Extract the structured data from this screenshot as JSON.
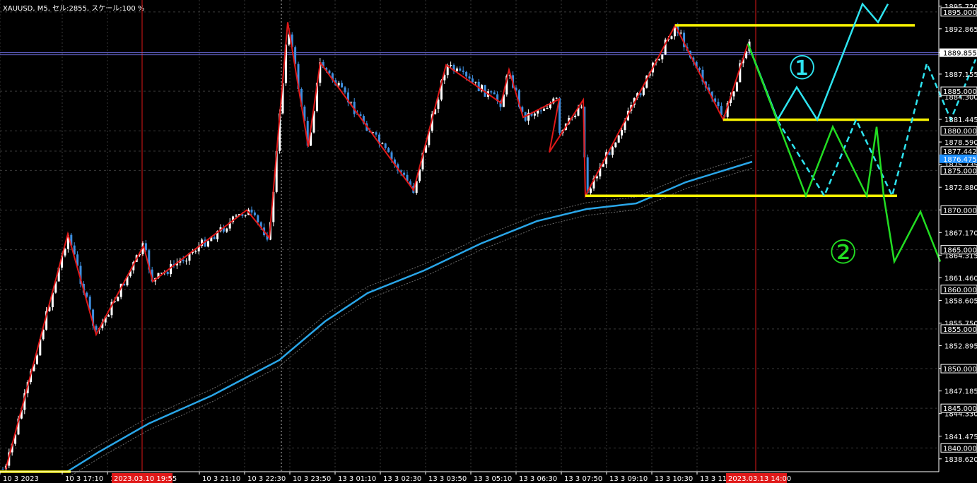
{
  "header": {
    "title": "XAUUSD, M5, セル:2855, スケール:100 %"
  },
  "colors": {
    "background": "#000000",
    "axis_text": "#ffffff",
    "grid": "#3a3a3a",
    "zigzag": "#e01818",
    "moving_average": "#2aa6e8",
    "envelope": "#6a6a6a",
    "support_resistance": "#f5f000",
    "scenario_1": "#2ee4f0",
    "scenario_2": "#22dd22",
    "current_price_tag": "#1e90ff",
    "date_tag": "#e01818",
    "bull_candle": "#ffffff",
    "bear_candle": "#3e8fe0"
  },
  "annotations": {
    "scenario_1_label": "①",
    "scenario_2_label": "②"
  },
  "chart_data": {
    "type": "candlestick",
    "symbol": "XAUUSD",
    "timeframe": "M5",
    "y_range": [
      1837.0,
      1896.5
    ],
    "price_labels": [
      "1895.720",
      "1892.865",
      "1889.855",
      "1887.155",
      "1884.300",
      "1881.445",
      "1878.590",
      "1875.735",
      "1872.880",
      "1870.025",
      "1867.170",
      "1864.315",
      "1861.460",
      "1858.605",
      "1855.750",
      "1852.895",
      "1850.040",
      "1847.185",
      "1844.330",
      "1841.475",
      "1838.620"
    ],
    "level_labels": [
      "1895.000",
      "1885.000",
      "1880.000",
      "1877.442",
      "1875.000",
      "1870.000",
      "1865.000",
      "1860.000",
      "1855.000",
      "1850.000",
      "1845.000",
      "1840.000"
    ],
    "current_price": "1876.475",
    "current_price_marker": "1889.855",
    "x_labels": [
      "10 3 2023",
      "10 3 17:10",
      "10 3 1",
      "10 3 21:10",
      "10 3 22:30",
      "10 3 23:50",
      "13 3 01:10",
      "13 3 02:30",
      "13 3 03:50",
      "13 3 05:10",
      "13 3 06:30",
      "13 3 07:50",
      "13 3 09:10",
      "13 3 10:30",
      "13 3 11:50"
    ],
    "date_tags": [
      "2023.03.10 19:55",
      "2023.03.13 14:00"
    ],
    "zigzag_prices": [
      1837.3,
      1867.0,
      1854.3,
      1865.5,
      1861.0,
      1870.0,
      1866.5,
      1893.7,
      1878.0,
      1888.6,
      1872.5,
      1888.3,
      1883.5,
      1887.7,
      1881.7,
      1884.0,
      1877.3,
      1883.9,
      1871.8,
      1893.3,
      1881.4,
      1891.0
    ],
    "horizontal_levels": [
      {
        "name": "resistance",
        "price": 1893.3
      },
      {
        "name": "middle",
        "price": 1881.4
      },
      {
        "name": "support",
        "price": 1871.8
      },
      {
        "name": "bottom",
        "price": 1837.0
      }
    ],
    "scenario_1_path": [
      1891.0,
      1881.4,
      1885.5,
      1881.4,
      1896.0,
      1893.7,
      1896.0
    ],
    "scenario_1_dashed_path": [
      1891.0,
      1881.4,
      1871.8,
      1881.4,
      1871.8,
      1888.5,
      1881.4,
      1889.0
    ],
    "scenario_2_path": [
      1891.0,
      1871.8,
      1880.5,
      1871.8,
      1880.5,
      1871.8,
      1863.5,
      1869.8,
      1863.5
    ]
  }
}
